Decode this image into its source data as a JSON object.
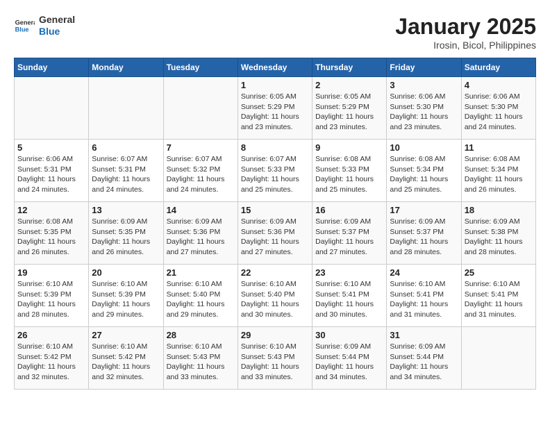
{
  "logo": {
    "line1": "General",
    "line2": "Blue"
  },
  "title": "January 2025",
  "subtitle": "Irosin, Bicol, Philippines",
  "weekdays": [
    "Sunday",
    "Monday",
    "Tuesday",
    "Wednesday",
    "Thursday",
    "Friday",
    "Saturday"
  ],
  "rows": [
    [
      {
        "day": "",
        "info": ""
      },
      {
        "day": "",
        "info": ""
      },
      {
        "day": "",
        "info": ""
      },
      {
        "day": "1",
        "info": "Sunrise: 6:05 AM\nSunset: 5:29 PM\nDaylight: 11 hours\nand 23 minutes."
      },
      {
        "day": "2",
        "info": "Sunrise: 6:05 AM\nSunset: 5:29 PM\nDaylight: 11 hours\nand 23 minutes."
      },
      {
        "day": "3",
        "info": "Sunrise: 6:06 AM\nSunset: 5:30 PM\nDaylight: 11 hours\nand 23 minutes."
      },
      {
        "day": "4",
        "info": "Sunrise: 6:06 AM\nSunset: 5:30 PM\nDaylight: 11 hours\nand 24 minutes."
      }
    ],
    [
      {
        "day": "5",
        "info": "Sunrise: 6:06 AM\nSunset: 5:31 PM\nDaylight: 11 hours\nand 24 minutes."
      },
      {
        "day": "6",
        "info": "Sunrise: 6:07 AM\nSunset: 5:31 PM\nDaylight: 11 hours\nand 24 minutes."
      },
      {
        "day": "7",
        "info": "Sunrise: 6:07 AM\nSunset: 5:32 PM\nDaylight: 11 hours\nand 24 minutes."
      },
      {
        "day": "8",
        "info": "Sunrise: 6:07 AM\nSunset: 5:33 PM\nDaylight: 11 hours\nand 25 minutes."
      },
      {
        "day": "9",
        "info": "Sunrise: 6:08 AM\nSunset: 5:33 PM\nDaylight: 11 hours\nand 25 minutes."
      },
      {
        "day": "10",
        "info": "Sunrise: 6:08 AM\nSunset: 5:34 PM\nDaylight: 11 hours\nand 25 minutes."
      },
      {
        "day": "11",
        "info": "Sunrise: 6:08 AM\nSunset: 5:34 PM\nDaylight: 11 hours\nand 26 minutes."
      }
    ],
    [
      {
        "day": "12",
        "info": "Sunrise: 6:08 AM\nSunset: 5:35 PM\nDaylight: 11 hours\nand 26 minutes."
      },
      {
        "day": "13",
        "info": "Sunrise: 6:09 AM\nSunset: 5:35 PM\nDaylight: 11 hours\nand 26 minutes."
      },
      {
        "day": "14",
        "info": "Sunrise: 6:09 AM\nSunset: 5:36 PM\nDaylight: 11 hours\nand 27 minutes."
      },
      {
        "day": "15",
        "info": "Sunrise: 6:09 AM\nSunset: 5:36 PM\nDaylight: 11 hours\nand 27 minutes."
      },
      {
        "day": "16",
        "info": "Sunrise: 6:09 AM\nSunset: 5:37 PM\nDaylight: 11 hours\nand 27 minutes."
      },
      {
        "day": "17",
        "info": "Sunrise: 6:09 AM\nSunset: 5:37 PM\nDaylight: 11 hours\nand 28 minutes."
      },
      {
        "day": "18",
        "info": "Sunrise: 6:09 AM\nSunset: 5:38 PM\nDaylight: 11 hours\nand 28 minutes."
      }
    ],
    [
      {
        "day": "19",
        "info": "Sunrise: 6:10 AM\nSunset: 5:39 PM\nDaylight: 11 hours\nand 28 minutes."
      },
      {
        "day": "20",
        "info": "Sunrise: 6:10 AM\nSunset: 5:39 PM\nDaylight: 11 hours\nand 29 minutes."
      },
      {
        "day": "21",
        "info": "Sunrise: 6:10 AM\nSunset: 5:40 PM\nDaylight: 11 hours\nand 29 minutes."
      },
      {
        "day": "22",
        "info": "Sunrise: 6:10 AM\nSunset: 5:40 PM\nDaylight: 11 hours\nand 30 minutes."
      },
      {
        "day": "23",
        "info": "Sunrise: 6:10 AM\nSunset: 5:41 PM\nDaylight: 11 hours\nand 30 minutes."
      },
      {
        "day": "24",
        "info": "Sunrise: 6:10 AM\nSunset: 5:41 PM\nDaylight: 11 hours\nand 31 minutes."
      },
      {
        "day": "25",
        "info": "Sunrise: 6:10 AM\nSunset: 5:41 PM\nDaylight: 11 hours\nand 31 minutes."
      }
    ],
    [
      {
        "day": "26",
        "info": "Sunrise: 6:10 AM\nSunset: 5:42 PM\nDaylight: 11 hours\nand 32 minutes."
      },
      {
        "day": "27",
        "info": "Sunrise: 6:10 AM\nSunset: 5:42 PM\nDaylight: 11 hours\nand 32 minutes."
      },
      {
        "day": "28",
        "info": "Sunrise: 6:10 AM\nSunset: 5:43 PM\nDaylight: 11 hours\nand 33 minutes."
      },
      {
        "day": "29",
        "info": "Sunrise: 6:10 AM\nSunset: 5:43 PM\nDaylight: 11 hours\nand 33 minutes."
      },
      {
        "day": "30",
        "info": "Sunrise: 6:09 AM\nSunset: 5:44 PM\nDaylight: 11 hours\nand 34 minutes."
      },
      {
        "day": "31",
        "info": "Sunrise: 6:09 AM\nSunset: 5:44 PM\nDaylight: 11 hours\nand 34 minutes."
      },
      {
        "day": "",
        "info": ""
      }
    ]
  ]
}
